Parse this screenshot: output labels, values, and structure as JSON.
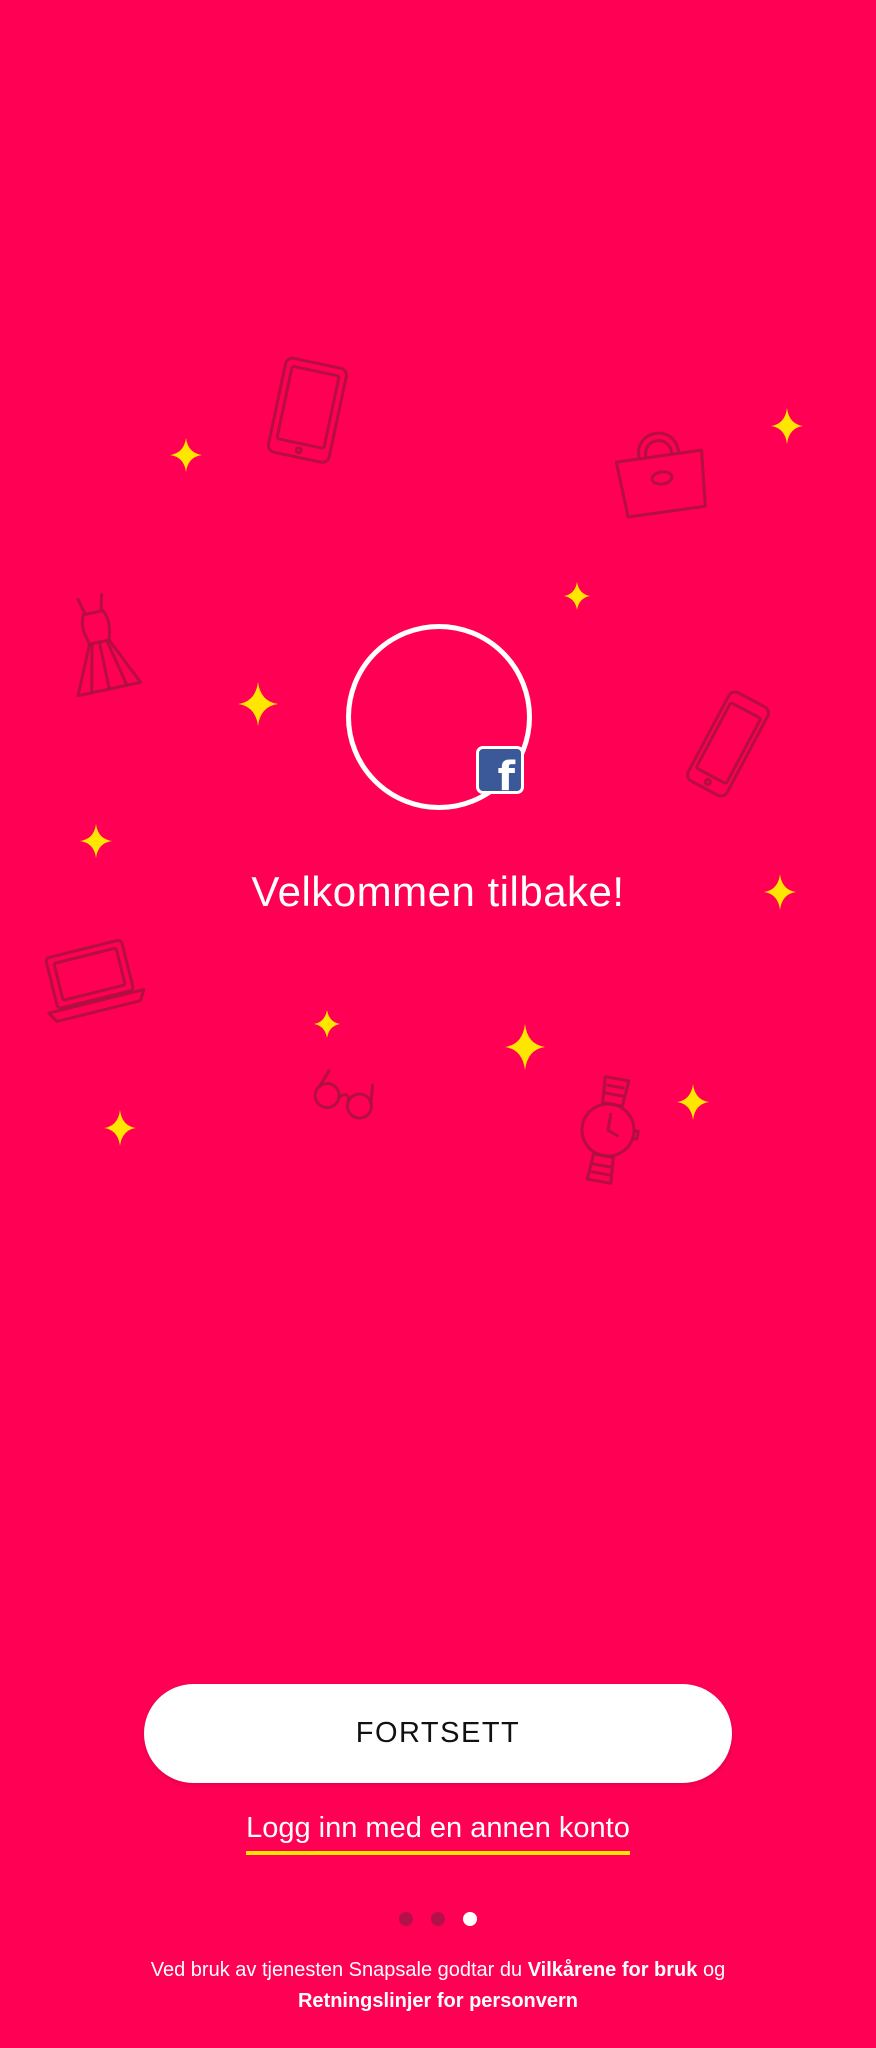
{
  "profile": {
    "badge_icon": "facebook-icon",
    "badge_color": "#3b5998",
    "welcome_text": "Velkommen tilbake!"
  },
  "actions": {
    "continue_label": "FORTSETT",
    "other_account_label": "Logg inn med en annen konto"
  },
  "pagination": {
    "total": 3,
    "active": 3
  },
  "legal": {
    "prefix": "Ved bruk av tjenesten Snapsale godtar du ",
    "terms_link": "Vilkårene for bruk",
    "conjunction": " og ",
    "privacy_link": "Retningslinjer for personvern"
  },
  "decor": {
    "icons": [
      "tablet-icon",
      "handbag-icon",
      "dress-icon",
      "smartphone-icon",
      "laptop-icon",
      "glasses-icon",
      "watch-icon"
    ],
    "sparkle_icon": "sparkle-icon"
  },
  "colors": {
    "background": "#ff0055",
    "accent": "#ffe600",
    "button": "#ffffff",
    "icon_outline": "#a8103f"
  }
}
